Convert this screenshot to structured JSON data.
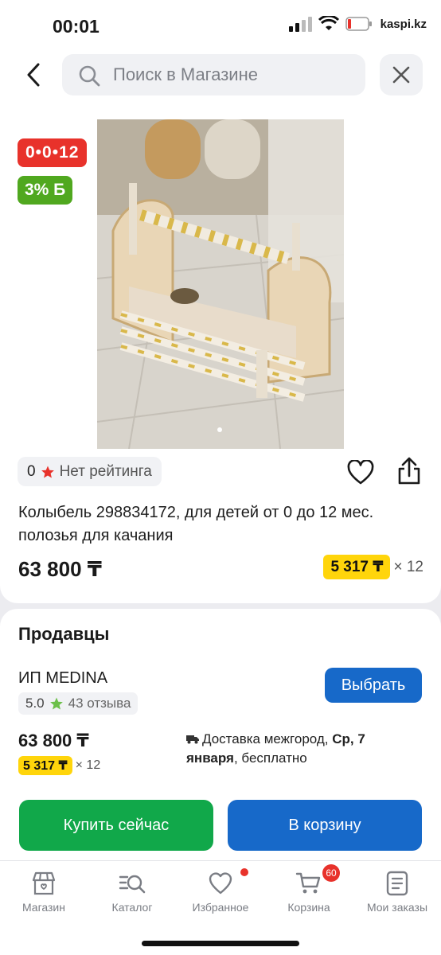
{
  "status_bar": {
    "time": "00:01",
    "carrier": "kaspi.kz"
  },
  "header": {
    "search_placeholder": "Поиск в Магазине"
  },
  "product": {
    "timer_badge": "0•0•12",
    "bonus_badge": "3% Б",
    "rating_value": "0",
    "rating_text": "Нет рейтинга",
    "title": "Колыбель 298834172, для детей от 0 до 12 мес. полозья для качания",
    "price": "63 800 ₸",
    "installment_amount": "5 317 ₸",
    "installment_times": "× 12"
  },
  "sellers": {
    "title": "Продавцы",
    "items": [
      {
        "name": "ИП MEDINA",
        "rating": "5.0",
        "reviews": "43 отзыва",
        "choose_label": "Выбрать",
        "price": "63 800 ₸",
        "installment_amount": "5 317 ₸",
        "installment_times": "× 12",
        "delivery_prefix": "Доставка межгород, ",
        "delivery_day": "Ср, 7 января",
        "delivery_suffix": ", бесплатно"
      }
    ],
    "buy_now_label": "Купить сейчас",
    "add_to_cart_label": "В корзину"
  },
  "bottom_nav": {
    "items": [
      {
        "label": "Магазин",
        "icon": "shop-icon"
      },
      {
        "label": "Каталог",
        "icon": "catalog-icon"
      },
      {
        "label": "Избранное",
        "icon": "heart-icon"
      },
      {
        "label": "Корзина",
        "icon": "cart-icon",
        "badge": "60"
      },
      {
        "label": "Мои заказы",
        "icon": "orders-icon"
      }
    ]
  },
  "colors": {
    "timer_red": "#e8322b",
    "bonus_green": "#50a81f",
    "installment_yellow": "#ffd50b",
    "primary_blue": "#1769c9",
    "buy_green": "#11a84a"
  }
}
